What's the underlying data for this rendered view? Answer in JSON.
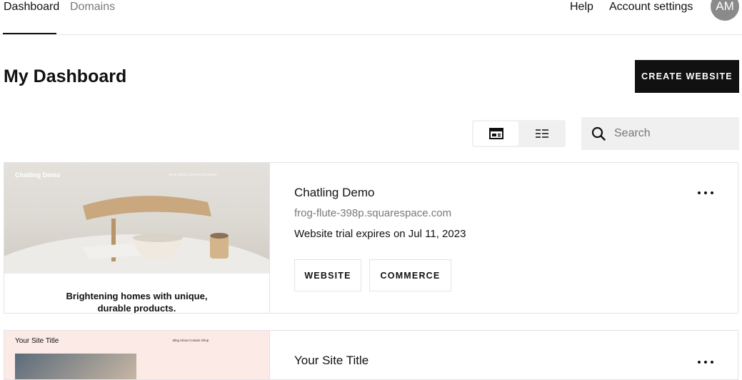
{
  "nav": {
    "tabs": [
      {
        "label": "Dashboard",
        "active": true
      },
      {
        "label": "Domains",
        "active": false
      }
    ],
    "help_label": "Help",
    "account_label": "Account settings",
    "avatar_initials": "AM"
  },
  "header": {
    "title": "My Dashboard",
    "create_label": "CREATE WEBSITE"
  },
  "toolbar": {
    "views": [
      {
        "icon": "card-view-icon",
        "active": true
      },
      {
        "icon": "list-view-icon",
        "active": false
      }
    ],
    "search_placeholder": "Search"
  },
  "sites": [
    {
      "name": "Chatling Demo",
      "url": "frog-flute-398p.squarespace.com",
      "status": "Website trial expires on Jul 11, 2023",
      "actions": [
        "WEBSITE",
        "COMMERCE"
      ],
      "thumbnail": {
        "site_name": "Chatling Demo",
        "nav": "Shop  About  Contact  Stockists",
        "caption_line1": "Brightening homes with unique,",
        "caption_line2": "durable products."
      }
    },
    {
      "name": "Your Site Title",
      "thumbnail": {
        "site_name": "Your Site Title",
        "nav": "Blog  About  Contact  Shop"
      }
    }
  ],
  "colors": {
    "primary": "#111111",
    "muted_text": "#7a7a7a",
    "surface": "#f0f0f0",
    "border": "#e3e3e3"
  }
}
